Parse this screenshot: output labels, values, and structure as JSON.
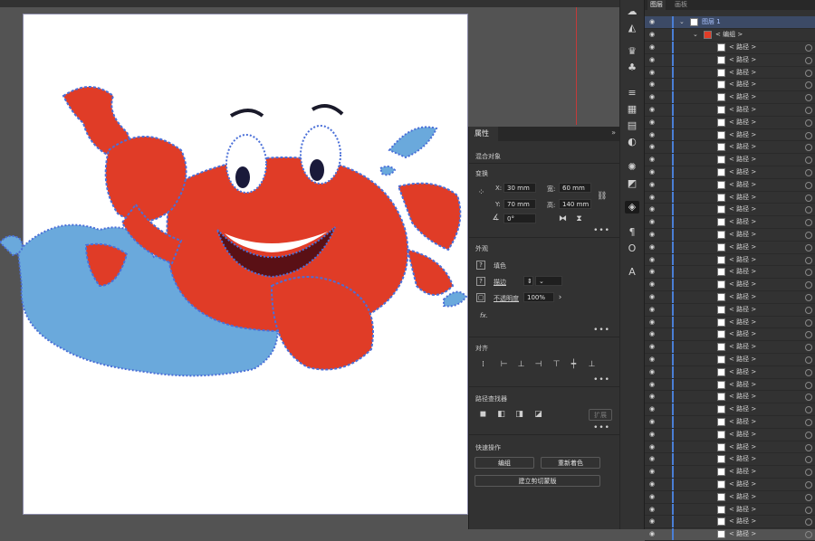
{
  "colors": {
    "crab_red": "#e03c27",
    "outline_blue": "#4a6fd8",
    "water_blue": "#6aa9dc",
    "panel": "#323232",
    "selection_row": "#3c4a66"
  },
  "layers_panel": {
    "tabs": [
      "图层",
      "画板"
    ],
    "layer_name": "图层 1",
    "group_name": "< 编组 >",
    "path_rows": [
      "< 路径 >",
      "< 路径 >",
      "< 路径 >",
      "< 路径 >",
      "< 路径 >",
      "< 路径 >",
      "< 路径 >",
      "< 路径 >",
      "< 路径 >",
      "< 路径 >",
      "< 路径 >",
      "< 路径 >",
      "< 路径 >",
      "< 路径 >",
      "< 路径 >",
      "< 路径 >",
      "< 路径 >",
      "< 路径 >",
      "< 路径 >",
      "< 路径 >",
      "< 路径 >",
      "< 路径 >",
      "< 路径 >",
      "< 路径 >",
      "< 路径 >",
      "< 路径 >",
      "< 路径 >",
      "< 路径 >",
      "< 路径 >",
      "< 路径 >",
      "< 路径 >",
      "< 路径 >",
      "< 路径 >",
      "< 路径 >",
      "< 路径 >",
      "< 路径 >",
      "< 路径 >",
      "< 路径 >",
      "< 路径 >",
      "< 路径 >"
    ]
  },
  "properties_panel": {
    "tab": "属性",
    "object_type": "混合对象",
    "transform": {
      "title": "变换",
      "x_label": "X:",
      "x_value": "30 mm",
      "width_label": "宽:",
      "width_value": "60 mm",
      "y_label": "Y:",
      "y_value": "70 mm",
      "height_label": "高:",
      "height_value": "140 mm",
      "angle_value": "0°"
    },
    "appearance": {
      "title": "外观",
      "fill_label": "填色",
      "stroke_label": "描边",
      "opacity_label": "不透明度",
      "opacity_value": "100%",
      "fx_label": "fx."
    },
    "align": {
      "title": "对齐"
    },
    "pathfinder": {
      "title": "路径查找器",
      "expand_label": "扩展"
    },
    "quick_actions": {
      "title": "快速操作",
      "edit_group": "编组",
      "recolor": "重新着色",
      "clip_mask": "建立剪切蒙版"
    }
  },
  "toolbar_icons": [
    "libraries-icon",
    "properties-icon",
    "paintbrush-icon",
    "symbol-spade-icon",
    "symbol-club-icon",
    "stroke-lines-icon",
    "swatches-icon",
    "gradient-icon",
    "transparency-icon",
    "color-guide-icon",
    "appearance-icon",
    "graphic-styles-icon",
    "layers-icon",
    "paragraph-icon",
    "glyph-icon",
    "character-icon"
  ]
}
